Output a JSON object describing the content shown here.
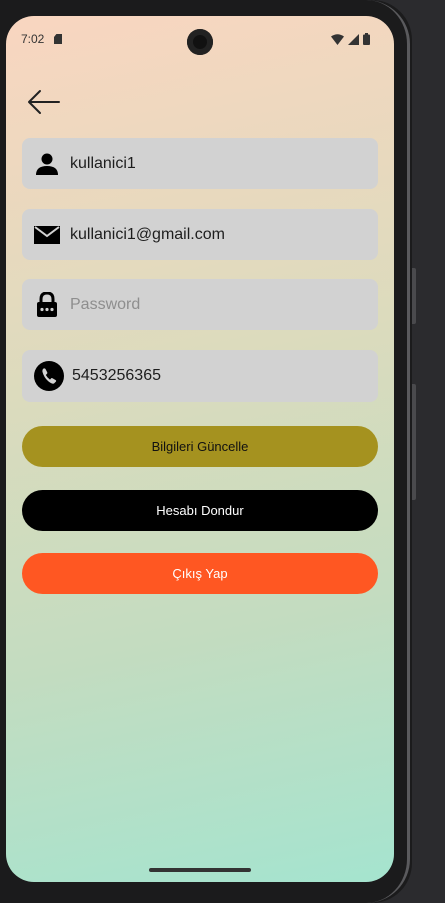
{
  "status_bar": {
    "time": "7:02",
    "icons": [
      "sd-card-icon",
      "wifi-icon",
      "signal-icon",
      "battery-icon"
    ]
  },
  "navigation": {
    "back_icon": "arrow-left-icon"
  },
  "form": {
    "username": {
      "icon": "person-icon",
      "value": "kullanici1"
    },
    "email": {
      "icon": "mail-icon",
      "value": "kullanici1@gmail.com"
    },
    "password": {
      "icon": "lock-icon",
      "value": "",
      "placeholder": "Password"
    },
    "phone": {
      "icon": "phone-icon",
      "value": "5453256365"
    }
  },
  "buttons": {
    "update": {
      "label": "Bilgileri Güncelle",
      "color": "#a5921f",
      "text_color": "#111111"
    },
    "freeze": {
      "label": "Hesabı Dondur",
      "color": "#000000",
      "text_color": "#ffffff"
    },
    "logout": {
      "label": "Çıkış Yap",
      "color": "#ff5722",
      "text_color": "#ffffff"
    }
  },
  "colors": {
    "gradient_top": "#f9d6c0",
    "gradient_bottom": "#a5e4cf",
    "field_background": "#d2d2d2"
  }
}
